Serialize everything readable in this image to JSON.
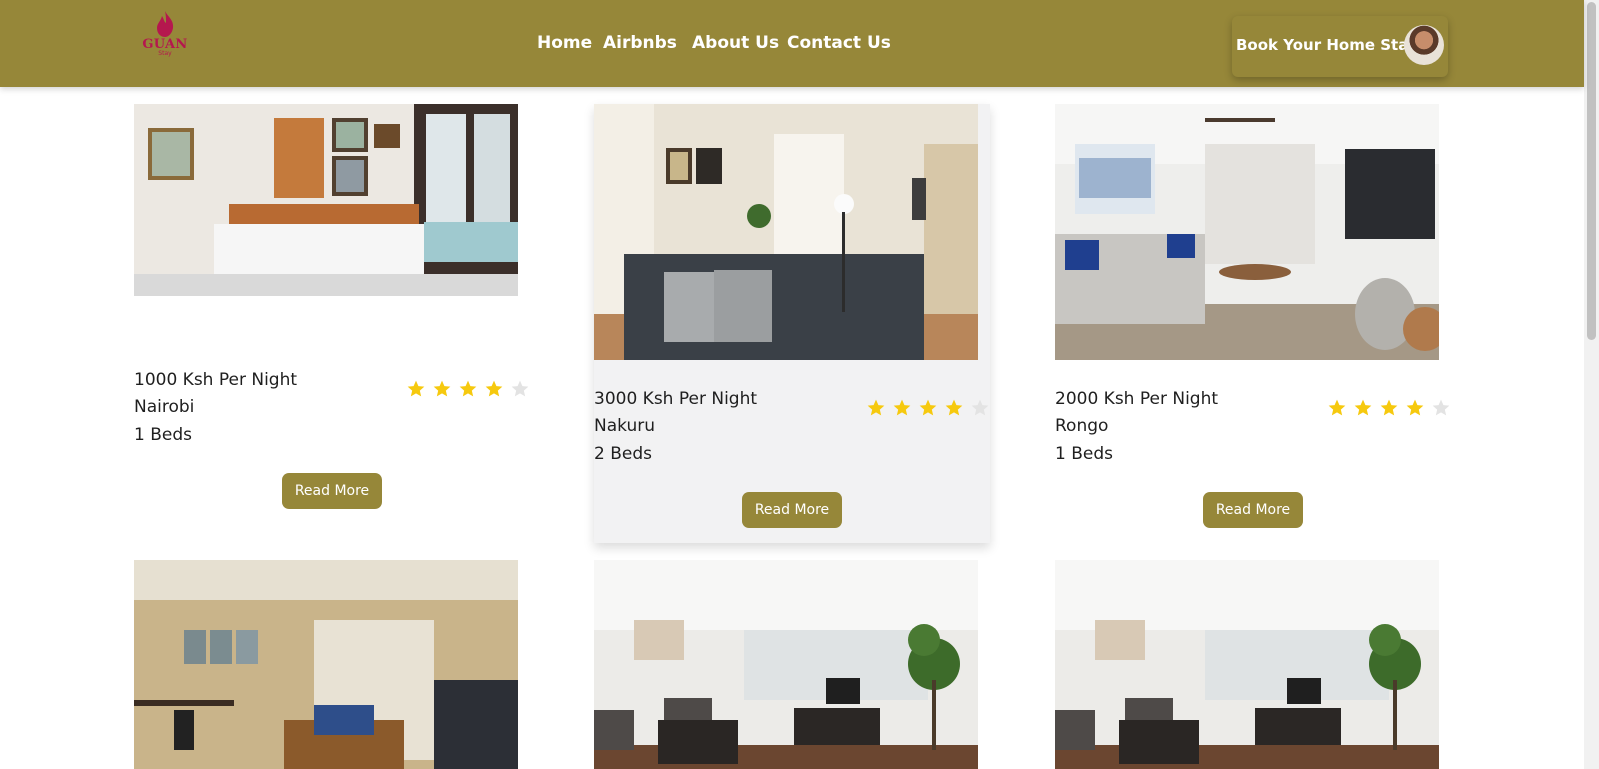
{
  "brand": {
    "name": "GUAN",
    "sub": "Stay",
    "colors": {
      "nav": "#968739",
      "logo": "#b5174e",
      "star": "#f6c90e",
      "star_empty": "#e3e3e3"
    }
  },
  "nav": {
    "links": [
      "Home",
      "Airbnbs",
      "About Us",
      "Contact Us"
    ],
    "cta": "Book Your Home Stay",
    "cta_icon": "user-avatar"
  },
  "listings": [
    {
      "price": "1000 Ksh Per Night",
      "location": "Nairobi",
      "beds": "1 Beds",
      "rating": 4,
      "max_rating": 5,
      "button": "Read More",
      "image": "bedroom-photo"
    },
    {
      "price": "3000 Ksh Per Night",
      "location": "Nakuru",
      "beds": "2 Beds",
      "rating": 4,
      "max_rating": 5,
      "button": "Read More",
      "image": "living-room-photo",
      "carousel_slides": 6,
      "active_slide": 1
    },
    {
      "price": "2000 Ksh Per Night",
      "location": "Rongo",
      "beds": "1 Beds",
      "rating": 4,
      "max_rating": 5,
      "button": "Read More",
      "image": "open-plan-living-photo"
    },
    {
      "image": "studio-living-photo"
    },
    {
      "image": "bright-lounge-photo"
    },
    {
      "image": "bright-lounge-photo"
    }
  ]
}
